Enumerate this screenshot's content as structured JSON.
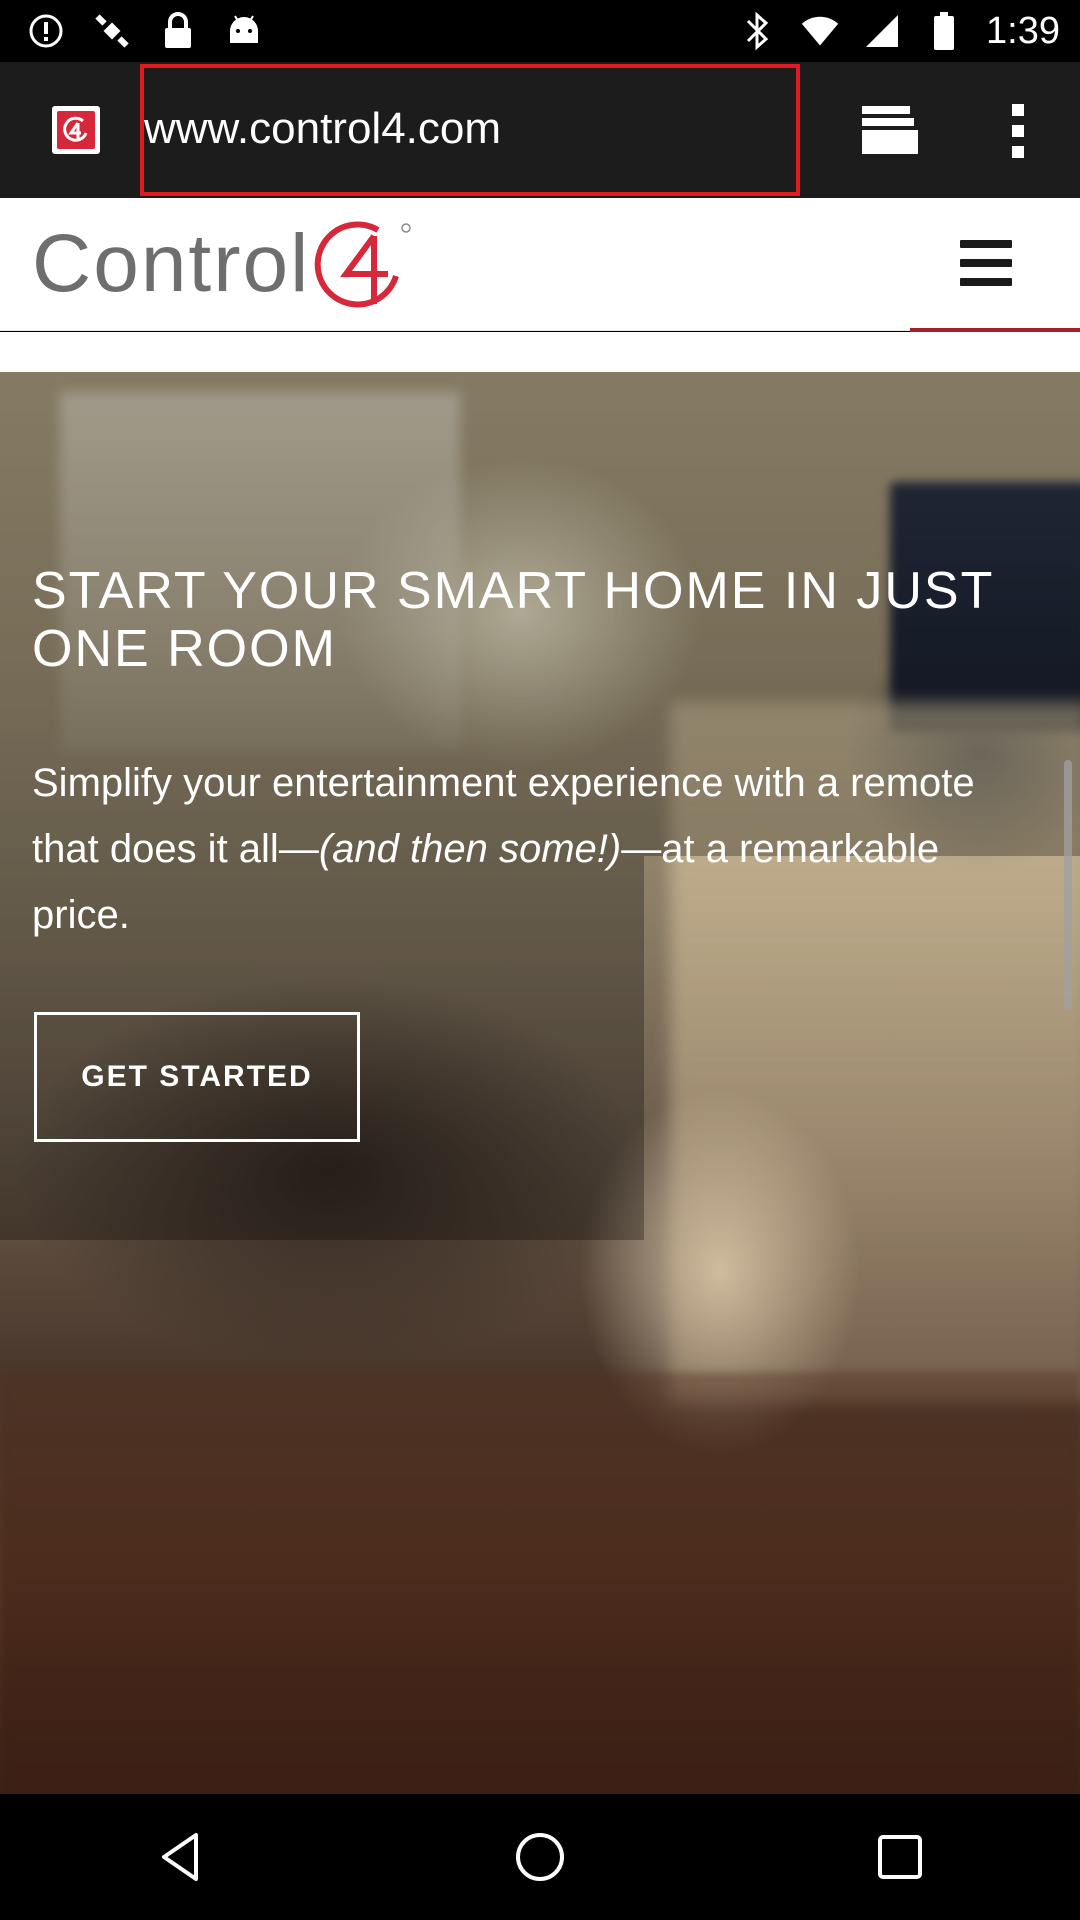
{
  "status_bar": {
    "time": "1:39",
    "left_icons": [
      "alert-circle-icon",
      "satellite-icon",
      "lock-icon",
      "android-icon"
    ],
    "right_icons": [
      "bluetooth-icon",
      "wifi-icon",
      "signal-icon",
      "battery-icon"
    ]
  },
  "browser": {
    "url": "www.control4.com",
    "favicon": "control4-favicon",
    "highlight_color": "#e11b22",
    "tabs_icon": "tabs-icon",
    "menu_icon": "overflow-menu-icon"
  },
  "site": {
    "logo_text": "Control",
    "logo_mark": "4",
    "brand_color": "#d7273b",
    "hero": {
      "title": "START YOUR SMART HOME IN JUST ONE ROOM",
      "text_before": "Simplify your entertainment experience with a remote that does it all—",
      "text_emphasis": "(and then some!)",
      "text_after": "—at a remarkable price.",
      "cta_label": "GET STARTED"
    }
  },
  "nav_bar": {
    "buttons": [
      "back-icon",
      "home-icon",
      "recents-icon"
    ]
  }
}
